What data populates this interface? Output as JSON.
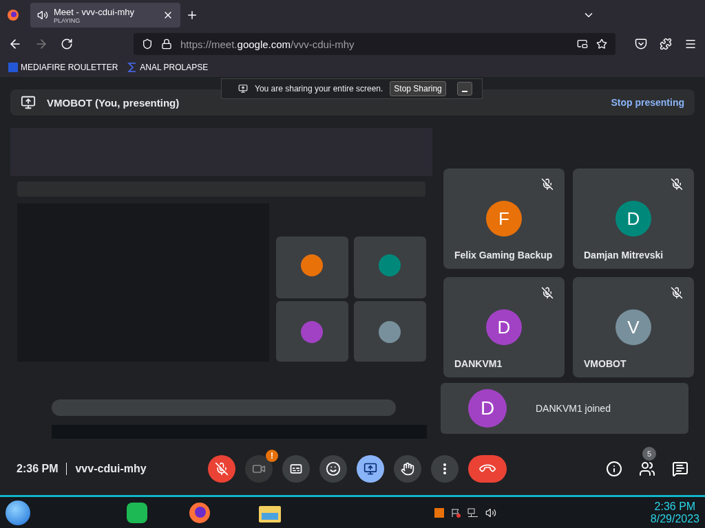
{
  "browser": {
    "tab": {
      "title": "Meet - vvv-cdui-mhy",
      "subtitle": "PLAYING",
      "playing": true
    },
    "url": "https://meet.**google.com**/vvv-cdui-mhy",
    "bookmarks": [
      {
        "label": "MEDIAFIRE ROULETTER",
        "kind": "square"
      },
      {
        "label": "ANAL PROLAPSE",
        "kind": "sigma"
      }
    ]
  },
  "sharing_bar": {
    "message": "You are sharing your entire screen.",
    "stop_button": "Stop Sharing"
  },
  "presenting": {
    "title": "VMOBOT (You, presenting)",
    "action": "Stop presenting"
  },
  "participants": [
    {
      "initial": "F",
      "name": "Felix Gaming Backup",
      "color": "#e8710a",
      "muted": true
    },
    {
      "initial": "D",
      "name": "Damjan Mitrevski",
      "color": "#00897b",
      "muted": true
    },
    {
      "initial": "D",
      "name": "DANKVM1",
      "color": "#a142c4",
      "muted": true
    },
    {
      "initial": "V",
      "name": "VMOBOT",
      "color": "#78909c",
      "muted": true
    }
  ],
  "notification": {
    "initial": "D",
    "text": "DANKVM1 joined",
    "color": "#a142c4"
  },
  "meeting": {
    "time": "2:36 PM",
    "code": "vvv-cdui-mhy",
    "mic_muted": true,
    "camera_alert": "!",
    "presenting": true,
    "people_count": "5"
  },
  "taskbar": {
    "time": "2:36 PM",
    "date": "8/29/2023"
  }
}
